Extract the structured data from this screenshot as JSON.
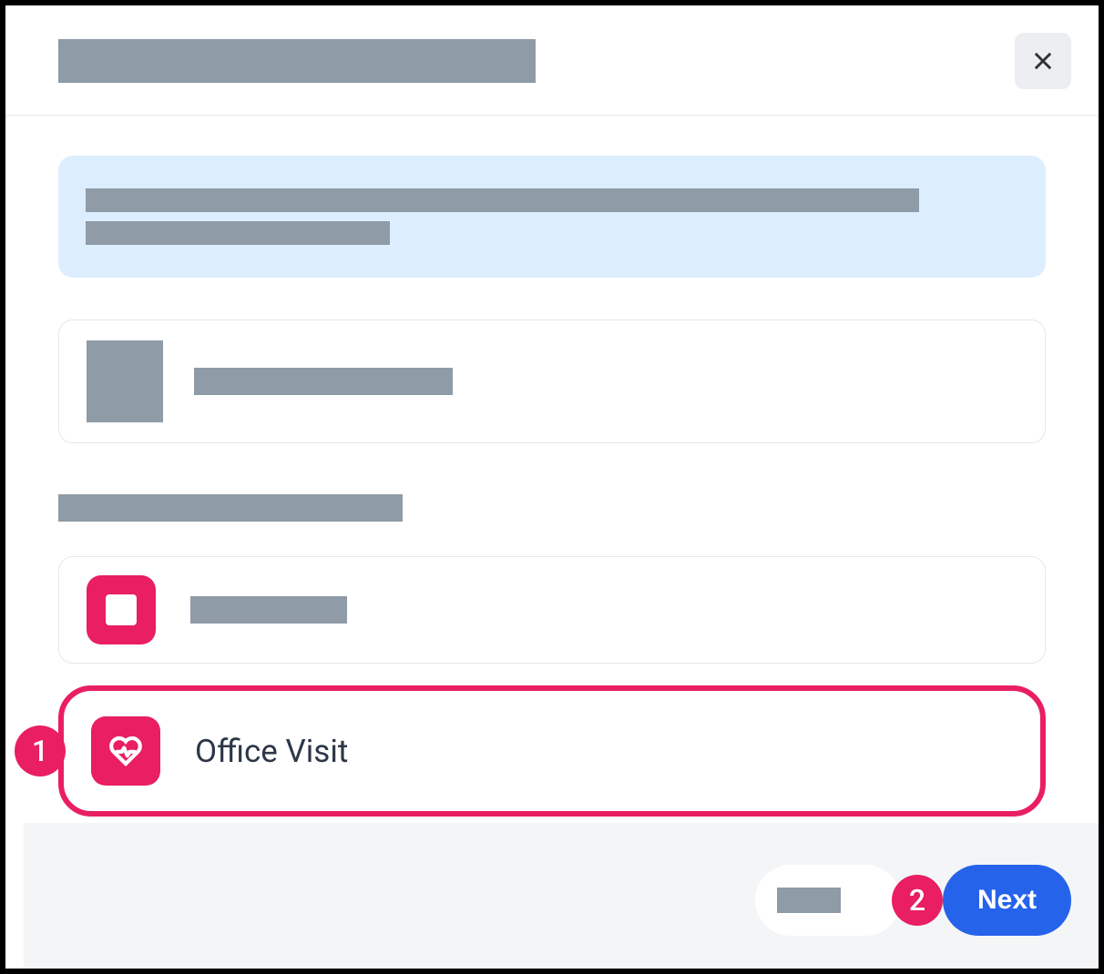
{
  "header": {
    "close_label": "Close"
  },
  "options": {
    "office_visit": {
      "label": "Office Visit"
    }
  },
  "callouts": {
    "one": "1",
    "two": "2"
  },
  "footer": {
    "next_label": "Next"
  }
}
